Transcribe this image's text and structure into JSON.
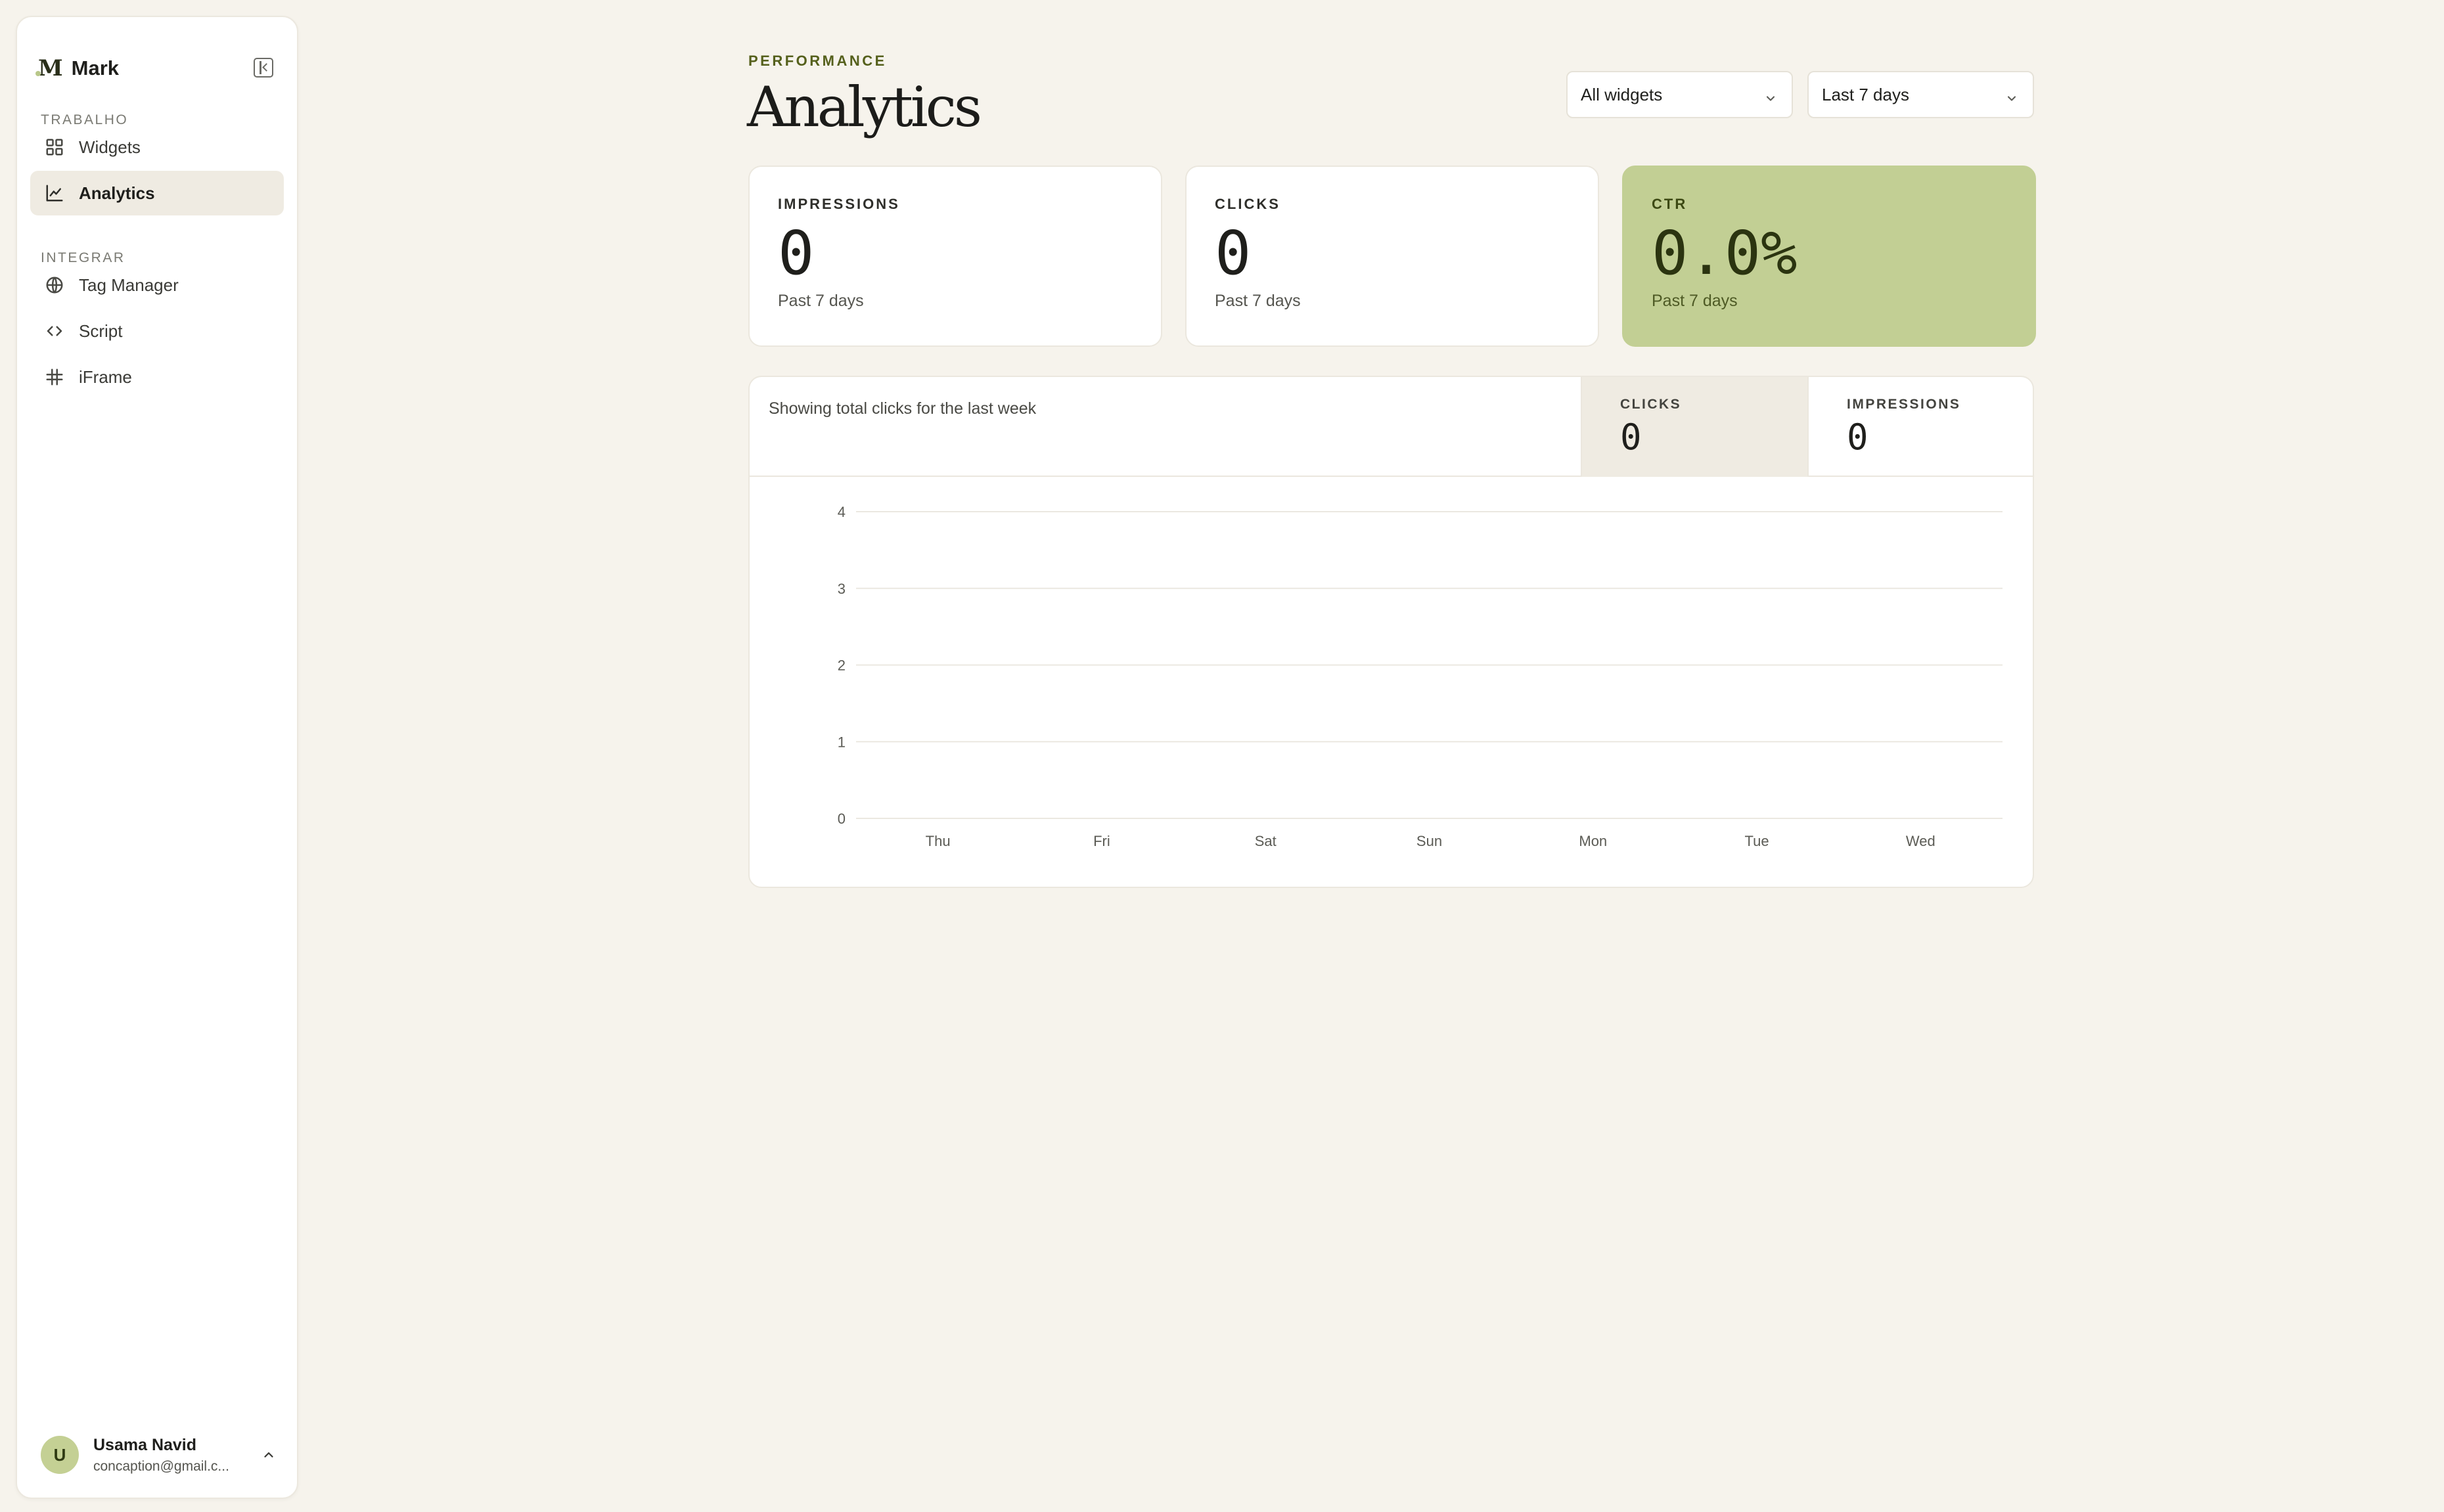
{
  "sidebar": {
    "brand": {
      "logo": "M",
      "name": "Mark"
    },
    "sections": [
      {
        "label": "TRABALHO"
      },
      {
        "label": "INTEGRAR"
      }
    ],
    "items": [
      {
        "label": "Widgets",
        "icon": "grid-icon"
      },
      {
        "label": "Analytics",
        "icon": "chart-line-icon",
        "active": true
      },
      {
        "label": "Tag Manager",
        "icon": "globe-icon"
      },
      {
        "label": "Script",
        "icon": "code-icon"
      },
      {
        "label": "iFrame",
        "icon": "hash-icon"
      }
    ],
    "user": {
      "initial": "U",
      "name": "Usama Navid",
      "email": "concaption@gmail.c..."
    }
  },
  "header": {
    "eyebrow": "PERFORMANCE",
    "title": "Analytics",
    "filters": {
      "widget": "All widgets",
      "range": "Last 7 days"
    }
  },
  "stats": [
    {
      "label": "IMPRESSIONS",
      "value": "0",
      "sub": "Past 7 days"
    },
    {
      "label": "CLICKS",
      "value": "0",
      "sub": "Past 7 days"
    },
    {
      "label": "CTR",
      "value": "0.0%",
      "sub": "Past 7 days"
    }
  ],
  "chart_panel": {
    "description": "Showing total clicks for the last week",
    "tabs": [
      {
        "label": "CLICKS",
        "value": "0",
        "active": true
      },
      {
        "label": "IMPRESSIONS",
        "value": "0"
      }
    ]
  },
  "colors": {
    "background": "#f6f3ec",
    "accent": "#c2cf94",
    "accent_text": "#55601c",
    "active_nav": "#efebe2"
  },
  "chart_data": {
    "type": "bar",
    "categories": [
      "Thu",
      "Fri",
      "Sat",
      "Sun",
      "Mon",
      "Tue",
      "Wed"
    ],
    "series": [
      {
        "values": [
          0,
          0,
          0,
          0,
          0,
          0,
          0
        ]
      }
    ],
    "yticks": [
      0,
      1,
      2,
      3,
      4
    ],
    "ylim": [
      0,
      4
    ],
    "grid": true,
    "legend": "none",
    "title": "",
    "xlabel": "",
    "ylabel": ""
  }
}
